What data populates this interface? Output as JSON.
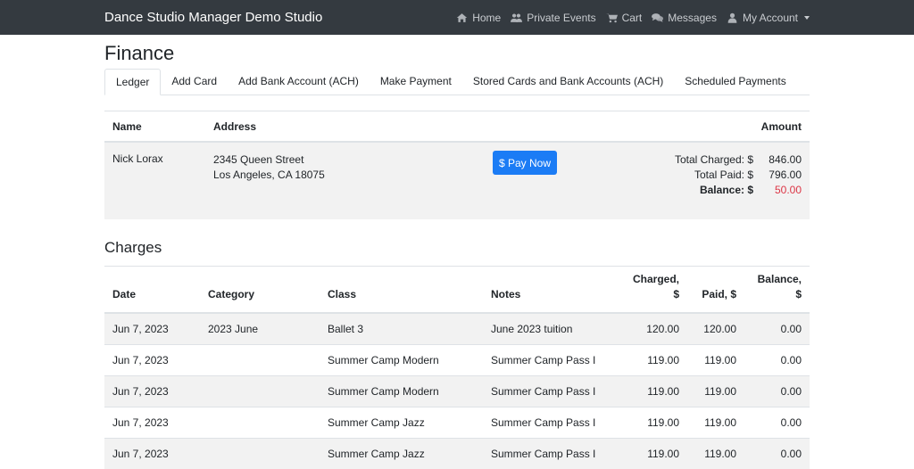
{
  "navbar": {
    "brand": "Dance Studio Manager Demo Studio",
    "links": [
      {
        "label": "Home",
        "icon": "home-icon"
      },
      {
        "label": "Private Events",
        "icon": "users-icon"
      },
      {
        "label": "Cart",
        "icon": "cart-icon"
      },
      {
        "label": "Messages",
        "icon": "comments-icon"
      },
      {
        "label": "My Account",
        "icon": "user-icon"
      }
    ]
  },
  "page": {
    "title": "Finance",
    "tabs": [
      "Ledger",
      "Add Card",
      "Add Bank Account (ACH)",
      "Make Payment",
      "Stored Cards and Bank Accounts (ACH)",
      "Scheduled Payments"
    ],
    "active_tab": "Ledger"
  },
  "ledger": {
    "headers": {
      "name": "Name",
      "address": "Address",
      "amount": "Amount"
    },
    "name": "Nick Lorax",
    "address_line1": "2345 Queen Street",
    "address_line2": "Los Angeles, CA 18075",
    "pay_button": "$ Pay Now",
    "total_charged_label": "Total Charged: $",
    "total_charged": "846.00",
    "total_paid_label": "Total Paid: $",
    "total_paid": "796.00",
    "balance_label": "Balance: $",
    "balance": "50.00",
    "balance_color": "#dc3545"
  },
  "charges": {
    "title": "Charges",
    "headers": {
      "date": "Date",
      "category": "Category",
      "class": "Class",
      "notes": "Notes",
      "charged_1": "Charged,",
      "charged_2": "$",
      "paid": "Paid, $",
      "balance_1": "Balance,",
      "balance_2": "$"
    },
    "rows": [
      {
        "date": "Jun 7, 2023",
        "category": "2023 June",
        "class": "Ballet 3",
        "notes": "June 2023 tuition",
        "charged": "120.00",
        "paid": "120.00",
        "balance": "0.00"
      },
      {
        "date": "Jun 7, 2023",
        "category": "",
        "class": "Summer Camp Modern",
        "notes": "Summer Camp Pass I",
        "charged": "119.00",
        "paid": "119.00",
        "balance": "0.00"
      },
      {
        "date": "Jun 7, 2023",
        "category": "",
        "class": "Summer Camp Modern",
        "notes": "Summer Camp Pass I",
        "charged": "119.00",
        "paid": "119.00",
        "balance": "0.00"
      },
      {
        "date": "Jun 7, 2023",
        "category": "",
        "class": "Summer Camp Jazz",
        "notes": "Summer Camp Pass I",
        "charged": "119.00",
        "paid": "119.00",
        "balance": "0.00"
      },
      {
        "date": "Jun 7, 2023",
        "category": "",
        "class": "Summer Camp Jazz",
        "notes": "Summer Camp Pass I",
        "charged": "119.00",
        "paid": "119.00",
        "balance": "0.00"
      }
    ]
  }
}
